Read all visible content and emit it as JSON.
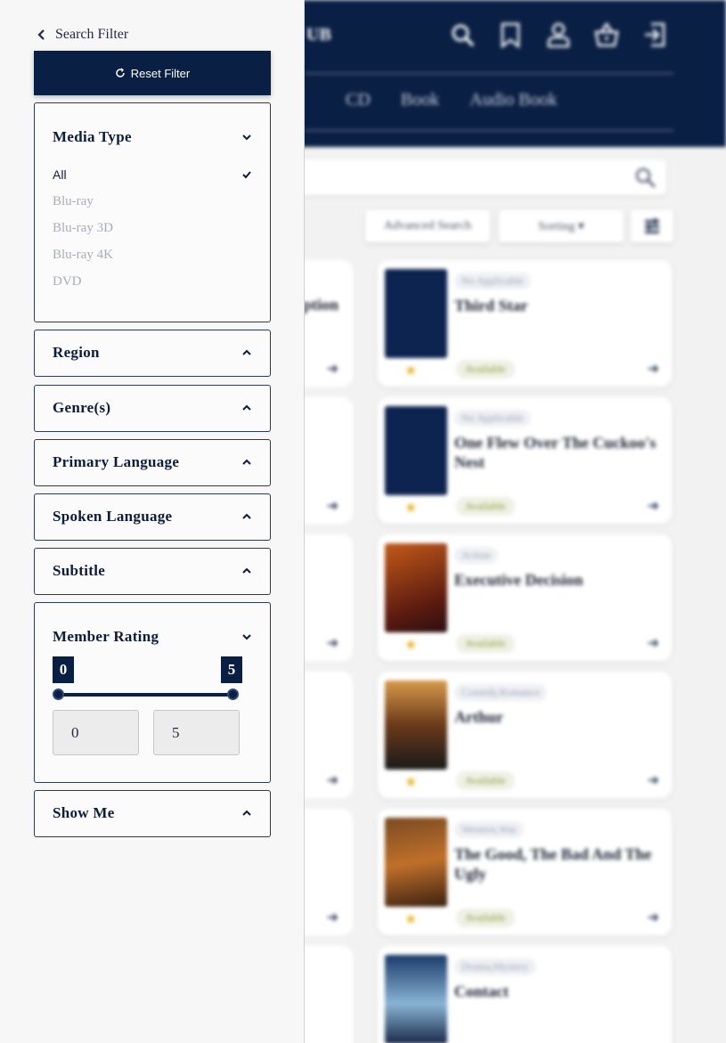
{
  "app": {
    "brand_fragment": "UB"
  },
  "header_icons": [
    "search-icon",
    "bookmark-icon",
    "user-icon",
    "basket-icon",
    "logout-icon"
  ],
  "nav": {
    "tabs": [
      "CD",
      "Book",
      "Audio Book"
    ]
  },
  "toolbar": {
    "advanced_search": "Advanced Search",
    "sorting": "Sorting ▾"
  },
  "cards": [
    {
      "genre": "No Applicable",
      "title": "Third Star",
      "status": "Available"
    },
    {
      "genre": "No Applicable",
      "title": "One Flew Over The Cuckoo's Nest",
      "status": "Available"
    },
    {
      "genre": "Action",
      "title": "Executive Decision",
      "status": "Available"
    },
    {
      "genre": "Comedy,Romance",
      "title": "Arthur",
      "status": "Available"
    },
    {
      "genre": "Western,War",
      "title": "The Good, The Bad And The Ugly",
      "status": "Available"
    },
    {
      "genre": "Drama,Mystery",
      "title": "Contact",
      "status": ""
    }
  ],
  "left_cards": [
    {
      "title_fragment": "ption"
    }
  ],
  "filter": {
    "back_label": "Search Filter",
    "reset_label": "Reset Filter",
    "media_type": {
      "label": "Media Type",
      "options": [
        "All",
        "Blu-ray",
        "Blu-ray 3D",
        "Blu-ray 4K",
        "DVD"
      ],
      "selected": "All"
    },
    "region": {
      "label": "Region"
    },
    "genres": {
      "label": "Genre(s)"
    },
    "primary_language": {
      "label": "Primary Language"
    },
    "spoken_language": {
      "label": "Spoken Language"
    },
    "subtitle": {
      "label": "Subtitle"
    },
    "member_rating": {
      "label": "Member Rating",
      "min": "0",
      "max": "5",
      "min_value": "0",
      "max_value": "5"
    },
    "show_me": {
      "label": "Show Me"
    }
  },
  "colors": {
    "navy": "#0a1f44",
    "panel_bg": "#f7f7f7",
    "available_green": "#8a9a3a",
    "star": "#e8b320"
  }
}
